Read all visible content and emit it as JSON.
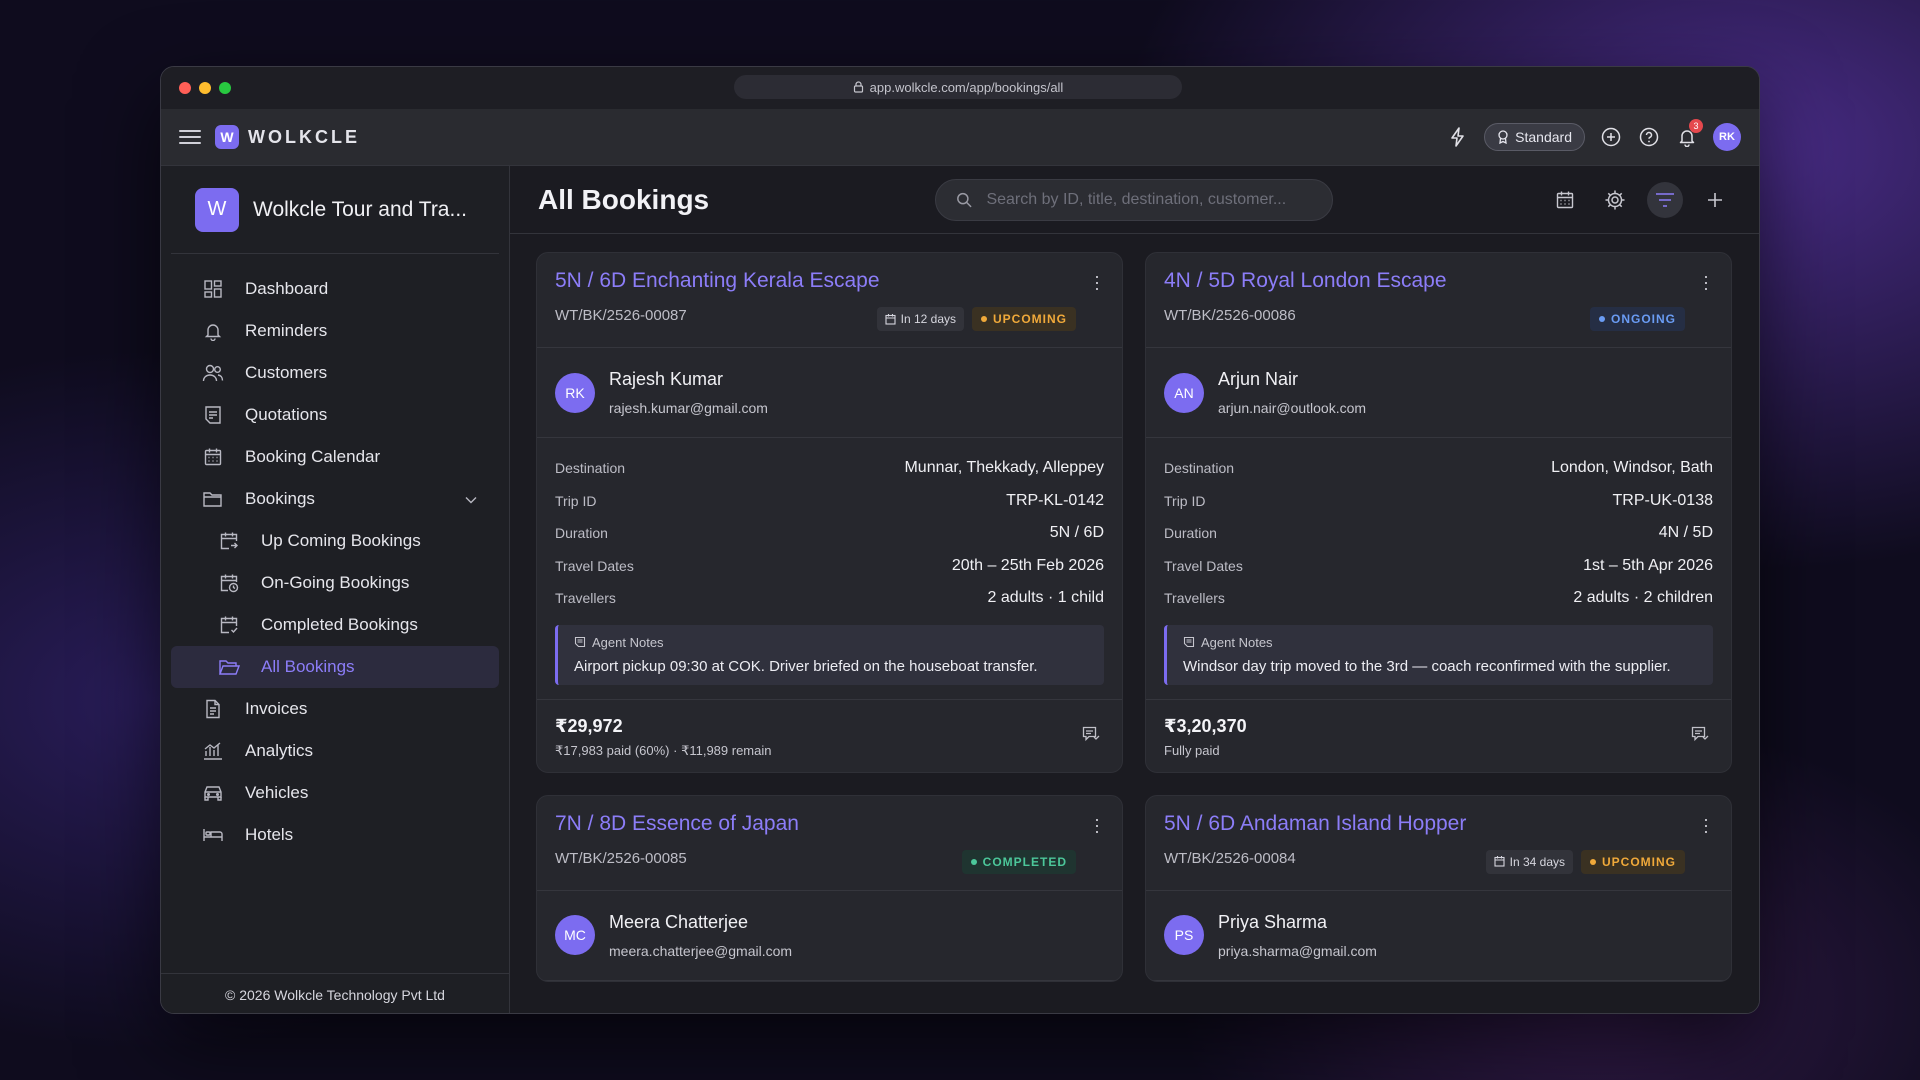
{
  "browser": {
    "url": "app.wolkcle.com/app/bookings/all"
  },
  "topbar": {
    "brand": "WOLKCLE",
    "logo_letter": "W",
    "plan": "Standard",
    "notification_count": "3",
    "user_initials": "RK"
  },
  "sidebar": {
    "company_letter": "W",
    "company_name": "Wolkcle Tour and Tra...",
    "items": [
      {
        "label": "Dashboard",
        "icon": "dashboard-icon"
      },
      {
        "label": "Reminders",
        "icon": "bell-icon"
      },
      {
        "label": "Customers",
        "icon": "users-icon"
      },
      {
        "label": "Quotations",
        "icon": "quote-icon"
      },
      {
        "label": "Booking Calendar",
        "icon": "calendar-icon"
      },
      {
        "label": "Bookings",
        "icon": "folder-icon"
      },
      {
        "label": "Up Coming Bookings",
        "icon": "calendar-arrow-icon"
      },
      {
        "label": "On-Going Bookings",
        "icon": "calendar-clock-icon"
      },
      {
        "label": "Completed Bookings",
        "icon": "calendar-check-icon"
      },
      {
        "label": "All Bookings",
        "icon": "folder-open-icon"
      },
      {
        "label": "Invoices",
        "icon": "invoice-icon"
      },
      {
        "label": "Analytics",
        "icon": "analytics-icon"
      },
      {
        "label": "Vehicles",
        "icon": "car-icon"
      },
      {
        "label": "Hotels",
        "icon": "bed-icon"
      }
    ],
    "footer": "© 2026  Wolkcle Technology Pvt Ltd"
  },
  "main": {
    "title": "All Bookings",
    "search_placeholder": "Search by ID, title, destination, customer...",
    "labels": {
      "destination": "Destination",
      "trip_id": "Trip ID",
      "duration": "Duration",
      "travel_dates": "Travel Dates",
      "travellers": "Travellers",
      "agent_notes": "Agent Notes"
    },
    "bookings": [
      {
        "title": "5N / 6D Enchanting Kerala Escape",
        "id": "WT/BK/2526-00087",
        "days": "In 12 days",
        "status": "UPCOMING",
        "initials": "RK",
        "name": "Rajesh Kumar",
        "email": "rajesh.kumar@gmail.com",
        "destination": "Munnar, Thekkady, Alleppey",
        "trip_id": "TRP-KL-0142",
        "duration": "5N / 6D",
        "travel_dates": "20th – 25th Feb 2026",
        "travellers": "2 adults · 1 child",
        "notes": "Airport pickup 09:30 at COK. Driver briefed on the houseboat transfer.",
        "amount": "₹29,972",
        "paid": "₹17,983 paid (60%) · ₹11,989 remain"
      },
      {
        "title": "4N / 5D Royal London Escape",
        "id": "WT/BK/2526-00086",
        "status": "ONGOING",
        "initials": "AN",
        "name": "Arjun Nair",
        "email": "arjun.nair@outlook.com",
        "destination": "London, Windsor, Bath",
        "trip_id": "TRP-UK-0138",
        "duration": "4N / 5D",
        "travel_dates": "1st – 5th Apr 2026",
        "travellers": "2 adults · 2 children",
        "notes": "Windsor day trip moved to the 3rd — coach reconfirmed with the supplier.",
        "amount": "₹3,20,370",
        "paid": "Fully paid"
      },
      {
        "title": "7N / 8D Essence of Japan",
        "id": "WT/BK/2526-00085",
        "status": "COMPLETED",
        "initials": "MC",
        "name": "Meera Chatterjee",
        "email": "meera.chatterjee@gmail.com"
      },
      {
        "title": "5N / 6D Andaman Island Hopper",
        "id": "WT/BK/2526-00084",
        "days": "In 34 days",
        "status": "UPCOMING",
        "initials": "PS",
        "name": "Priya Sharma",
        "email": "priya.sharma@gmail.com"
      }
    ]
  },
  "colors": {
    "accent": "#7c6cf0",
    "upcoming": "#f0a93a",
    "ongoing": "#6a9cf4",
    "completed": "#4cc79a"
  }
}
